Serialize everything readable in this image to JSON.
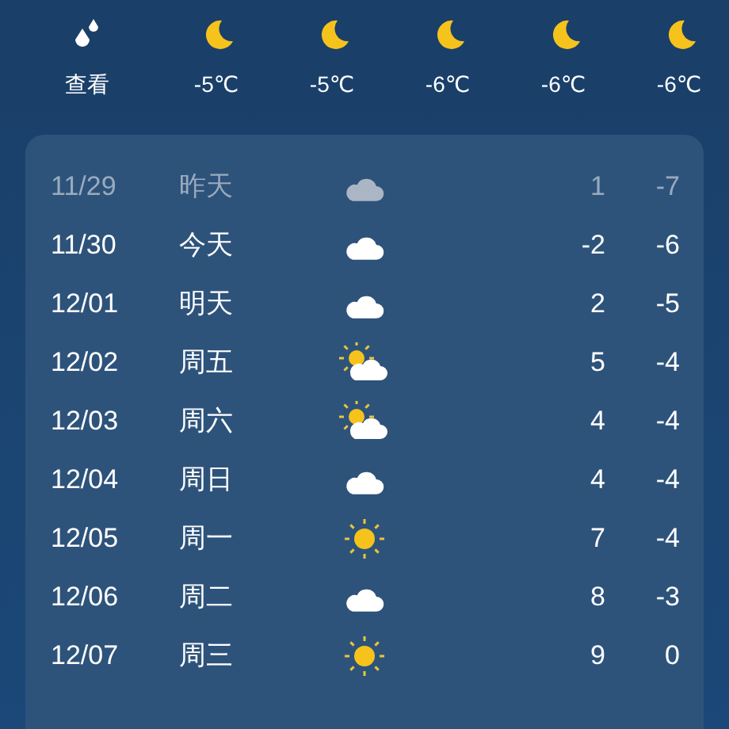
{
  "hourly": [
    {
      "kind": "rain",
      "label": "查看"
    },
    {
      "kind": "moon",
      "label": "-5℃"
    },
    {
      "kind": "moon",
      "label": "-5℃"
    },
    {
      "kind": "moon",
      "label": "-6℃"
    },
    {
      "kind": "moon",
      "label": "-6℃"
    },
    {
      "kind": "moon",
      "label": "-6℃"
    }
  ],
  "daily": [
    {
      "date": "11/29",
      "day": "昨天",
      "kind": "cloud",
      "high": "1",
      "low": "-7",
      "past": true
    },
    {
      "date": "11/30",
      "day": "今天",
      "kind": "cloud",
      "high": "-2",
      "low": "-6",
      "past": false
    },
    {
      "date": "12/01",
      "day": "明天",
      "kind": "cloud",
      "high": "2",
      "low": "-5",
      "past": false
    },
    {
      "date": "12/02",
      "day": "周五",
      "kind": "partly-cloudy",
      "high": "5",
      "low": "-4",
      "past": false
    },
    {
      "date": "12/03",
      "day": "周六",
      "kind": "partly-cloudy",
      "high": "4",
      "low": "-4",
      "past": false
    },
    {
      "date": "12/04",
      "day": "周日",
      "kind": "cloud",
      "high": "4",
      "low": "-4",
      "past": false
    },
    {
      "date": "12/05",
      "day": "周一",
      "kind": "sun",
      "high": "7",
      "low": "-4",
      "past": false
    },
    {
      "date": "12/06",
      "day": "周二",
      "kind": "cloud",
      "high": "8",
      "low": "-3",
      "past": false
    },
    {
      "date": "12/07",
      "day": "周三",
      "kind": "sun",
      "high": "9",
      "low": "0",
      "past": false
    }
  ]
}
